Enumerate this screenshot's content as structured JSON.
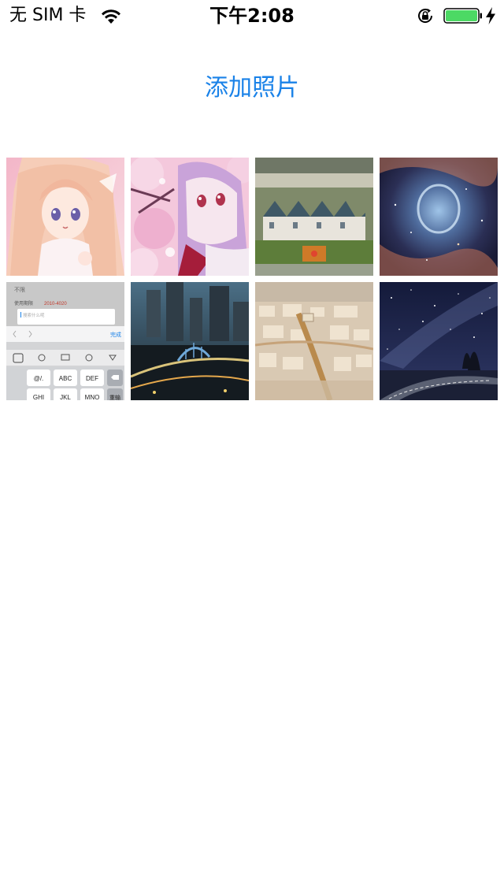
{
  "status_bar": {
    "carrier": "无 SIM 卡",
    "time": "下午2:08",
    "battery_color": "#4cd964",
    "icons": [
      "wifi-icon",
      "orientation-lock-icon",
      "battery-icon",
      "charging-bolt-icon"
    ]
  },
  "main": {
    "add_photo_label": "添加照片",
    "accent_color": "#1a82e8",
    "photos": [
      {
        "name": "photo-anime-girl-pink"
      },
      {
        "name": "photo-anime-girl-blossoms"
      },
      {
        "name": "photo-tiltshift-houses"
      },
      {
        "name": "photo-nebula"
      },
      {
        "name": "photo-keyboard-screenshot",
        "text": {
          "tab_a": "不限",
          "row_label": "使用期限",
          "row_value": "2010-4020",
          "input_placeholder": "搜索什么呢",
          "done": "完成",
          "keys": [
            "@/.",
            "ABC",
            "DEF",
            "GHI",
            "JKL",
            "MNO",
            "重输"
          ]
        }
      },
      {
        "name": "photo-city-bridge-night"
      },
      {
        "name": "photo-city-aerial"
      },
      {
        "name": "photo-milky-way-road"
      }
    ]
  }
}
